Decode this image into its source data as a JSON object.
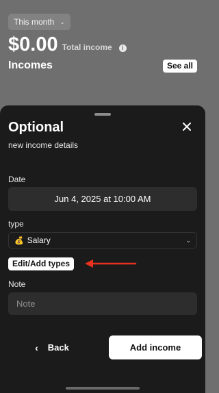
{
  "header": {
    "period": "This month",
    "total_amount": "$0.00",
    "total_label": "Total income",
    "section_title": "Incomes",
    "see_all_label": "See all"
  },
  "sheet": {
    "title": "Optional",
    "subtitle": "new income details",
    "date_label": "Date",
    "date_value": "Jun 4, 2025 at 10:00 AM",
    "type_label": "type",
    "type_emoji": "💰",
    "type_value": "Salary",
    "edit_types_label": "Edit/Add types",
    "note_label": "Note",
    "note_placeholder": "Note",
    "note_value": "",
    "back_label": "Back",
    "add_label": "Add income"
  },
  "colors": {
    "backdrop": "#6f6f6f",
    "sheet": "#1b1b1b",
    "field": "#2d2d2d",
    "annotation_arrow": "#e8321f"
  },
  "icons": [
    "chevron-down-icon",
    "info-icon",
    "close-icon",
    "chevron-left-icon",
    "arrow-left-icon"
  ]
}
